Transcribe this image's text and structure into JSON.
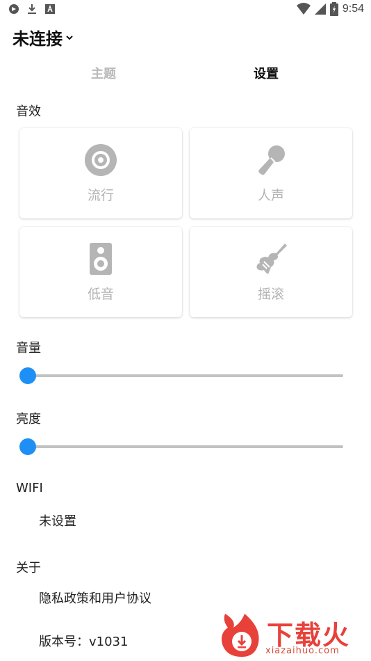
{
  "status_bar": {
    "time": "9:54",
    "left_icons": [
      "sync-icon",
      "download-icon",
      "a-badge-icon"
    ],
    "right_icons": [
      "wifi-icon",
      "signal-icon",
      "battery-icon"
    ]
  },
  "header": {
    "title": "未连接",
    "dropdown_icon": "chevron-down-icon"
  },
  "tabs": [
    {
      "label": "主题",
      "active": false
    },
    {
      "label": "设置",
      "active": true
    }
  ],
  "sound_effects": {
    "label": "音效",
    "presets": [
      {
        "label": "流行",
        "icon": "disc-icon"
      },
      {
        "label": "人声",
        "icon": "microphone-icon"
      },
      {
        "label": "低音",
        "icon": "speaker-icon"
      },
      {
        "label": "摇滚",
        "icon": "guitar-icon"
      }
    ]
  },
  "volume": {
    "label": "音量",
    "value": 0
  },
  "brightness": {
    "label": "亮度",
    "value": 0
  },
  "wifi": {
    "label": "WIFI",
    "value": "未设置"
  },
  "about": {
    "label": "关于",
    "privacy": "隐私政策和用户协议",
    "version": "版本号：v1031"
  },
  "watermark": {
    "text": "下载火",
    "url": "xiazaihuo.com"
  },
  "colors": {
    "accent": "#1e90f5",
    "icon_gray": "#b5b5b5",
    "watermark_red": "#e8413a"
  }
}
